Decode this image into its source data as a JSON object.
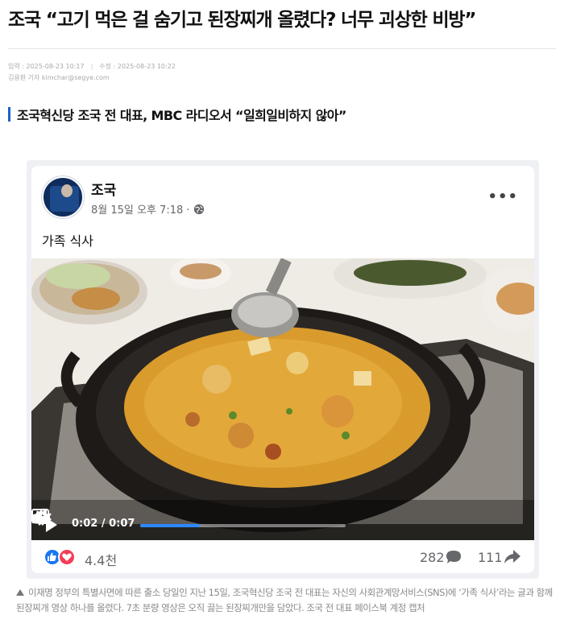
{
  "article": {
    "headline": "조국 “고기 먹은 걸 숨기고 된장찌개 올렸다? 너무 괴상한 비방”",
    "meta": {
      "input_label": "입력 : 2025-08-23 10:17",
      "edit_label": "수정 : 2025-08-23 10:22",
      "reporter": "김용환 기자 kimchar@segye.com"
    },
    "subhead": "조국혁신당 조국 전 대표, MBC 라디오서 “일희일비하지 않아”",
    "photo_caption": "이재명 정부의 특별사면에 따른 출소 당일인 지난 15일, 조국혁신당 조국 전 대표는 자신의 사회관계망서비스(SNS)에 ‘가족 식사’라는 글과 함께 된장찌개 영상 하나를 올렸다. 7초 분량 영상은 오직 끓는 된장찌개만을 담았다. 조국 전 대표 페이스북 계정 캡처"
  },
  "post": {
    "author": "조국",
    "timestamp": "8월 15일 오후 7:18 ·",
    "caption": "가족 식사",
    "video": {
      "time_display": "0:02 / 0:07",
      "progress": 0.29
    },
    "reactions": "4.4천",
    "comments": "282",
    "shares": "111"
  },
  "colors": {
    "accent_blue": "#1a63c7",
    "fb_blue": "#1877f2",
    "progress_blue": "#2d88ff",
    "love_red": "#f33e58"
  },
  "icons": [
    "globe-icon",
    "more-icon",
    "play-icon",
    "gear-icon",
    "expand-icon",
    "pip-icon",
    "mute-icon",
    "like-icon",
    "love-icon",
    "comment-icon",
    "share-icon",
    "caption-marker-icon"
  ]
}
